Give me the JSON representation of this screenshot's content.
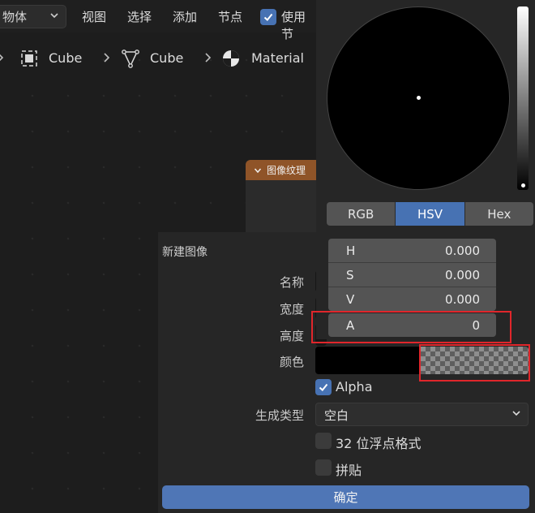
{
  "header": {
    "object_dropdown": "物体",
    "menus": [
      "视图",
      "选择",
      "添加",
      "节点"
    ],
    "use_nodes_label": "使用节"
  },
  "breadcrumb": {
    "items": [
      {
        "icon": "object-icon",
        "label": "Cube"
      },
      {
        "icon": "mesh-icon",
        "label": "Cube"
      },
      {
        "icon": "material-icon",
        "label": "Material"
      }
    ]
  },
  "node": {
    "title": "图像纹理"
  },
  "dialog": {
    "title": "新建图像",
    "name_label": "名称",
    "width_label": "宽度",
    "height_label": "高度",
    "color_label": "颜色",
    "alpha_label": "Alpha",
    "alpha_checked": true,
    "gen_type_label": "生成类型",
    "gen_type_value": "空白",
    "float_label": "32 位浮点格式",
    "float_checked": false,
    "tiled_label": "拼贴",
    "tiled_checked": false,
    "ok_label": "确定"
  },
  "picker": {
    "modes": [
      "RGB",
      "HSV",
      "Hex"
    ],
    "active_mode": "HSV",
    "fields": [
      {
        "label": "H",
        "value": "0.000"
      },
      {
        "label": "S",
        "value": "0.000"
      },
      {
        "label": "V",
        "value": "0.000"
      },
      {
        "label": "A",
        "value": "0"
      }
    ]
  },
  "colors": {
    "accent": "#4772b3",
    "node_header": "#8f5428",
    "highlight": "#e0262b"
  }
}
